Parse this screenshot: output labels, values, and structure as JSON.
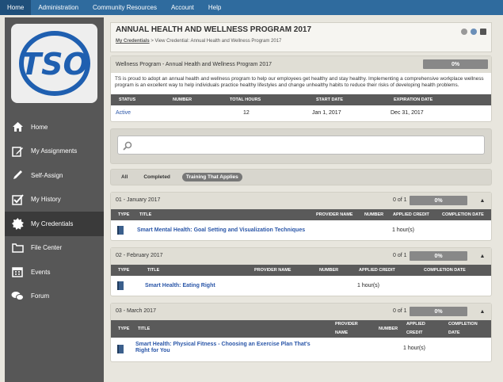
{
  "topnav": {
    "items": [
      "Home",
      "Administration",
      "Community Resources",
      "Account",
      "Help"
    ]
  },
  "logo": {
    "text": "TSO"
  },
  "sidebar": {
    "items": [
      {
        "label": "Home",
        "icon": "home-icon"
      },
      {
        "label": "My Assignments",
        "icon": "edit-icon"
      },
      {
        "label": "Self-Assign",
        "icon": "pencil-icon"
      },
      {
        "label": "My History",
        "icon": "checkbox-icon"
      },
      {
        "label": "My Credentials",
        "icon": "badge-icon"
      },
      {
        "label": "File Center",
        "icon": "folder-icon"
      },
      {
        "label": "Events",
        "icon": "calendar-icon"
      },
      {
        "label": "Forum",
        "icon": "chat-icon"
      }
    ],
    "active": "My Credentials"
  },
  "header": {
    "title": "ANNUAL HEALTH AND WELLNESS PROGRAM 2017",
    "crumb_link": "My Credentials",
    "crumb_rest": " > View Credential: Annual Health and Wellness Program 2017"
  },
  "program": {
    "title": "Wellness Program - Annual Health and Wellness Program 2017",
    "progress": "0%",
    "description": "TS is proud to adopt an annual health and wellness program to help our employees get healthy and stay healthy. Implementing a comprehensive workplace wellness program is an excellent way to help individuals practice healthy lifestyles and change unhealthy habits to reduce their risks of developing health problems.",
    "columns": [
      "STATUS",
      "NUMBER",
      "TOTAL HOURS",
      "START DATE",
      "EXPIRATION DATE"
    ],
    "row": {
      "status": "Active",
      "number": "",
      "total_hours": "12",
      "start_date": "Jan 1, 2017",
      "expiration_date": "Dec 31, 2017"
    }
  },
  "filters": {
    "tabs": [
      "All",
      "Completed",
      "Training That Applies"
    ],
    "selected": "Training That Applies"
  },
  "sections": [
    {
      "title": "01 - January 2017",
      "count": "0 of 1",
      "progress": "0%",
      "columns": [
        "TYPE",
        "TITLE",
        "PROVIDER NAME",
        "NUMBER",
        "APPLIED CREDIT",
        "COMPLETION DATE"
      ],
      "course": "Smart Mental Health: Goal Setting and Visualization Techniques",
      "credit": "1 hour(s)"
    },
    {
      "title": "02 - February 2017",
      "count": "0 of 1",
      "progress": "0%",
      "columns": [
        "TYPE",
        "TITLE",
        "PROVIDER NAME",
        "NUMBER",
        "APPLIED CREDIT",
        "COMPLETION DATE"
      ],
      "course": "Smart Health: Eating Right",
      "credit": "1 hour(s)"
    },
    {
      "title": "03 - March 2017",
      "count": "0 of 1",
      "progress": "0%",
      "columns": [
        "TYPE",
        "TITLE",
        "PROVIDER",
        "NAME",
        "NUMBER",
        "APPLIED",
        "CREDIT",
        "COMPLETION",
        "DATE"
      ],
      "course": "Smart Health: Physical Fitness - Choosing an Exercise Plan That's Right for You",
      "credit": "1 hour(s)"
    }
  ],
  "colors": {
    "nav": "#2f6b9e",
    "sidebar": "#575757",
    "link": "#2a56a8"
  }
}
